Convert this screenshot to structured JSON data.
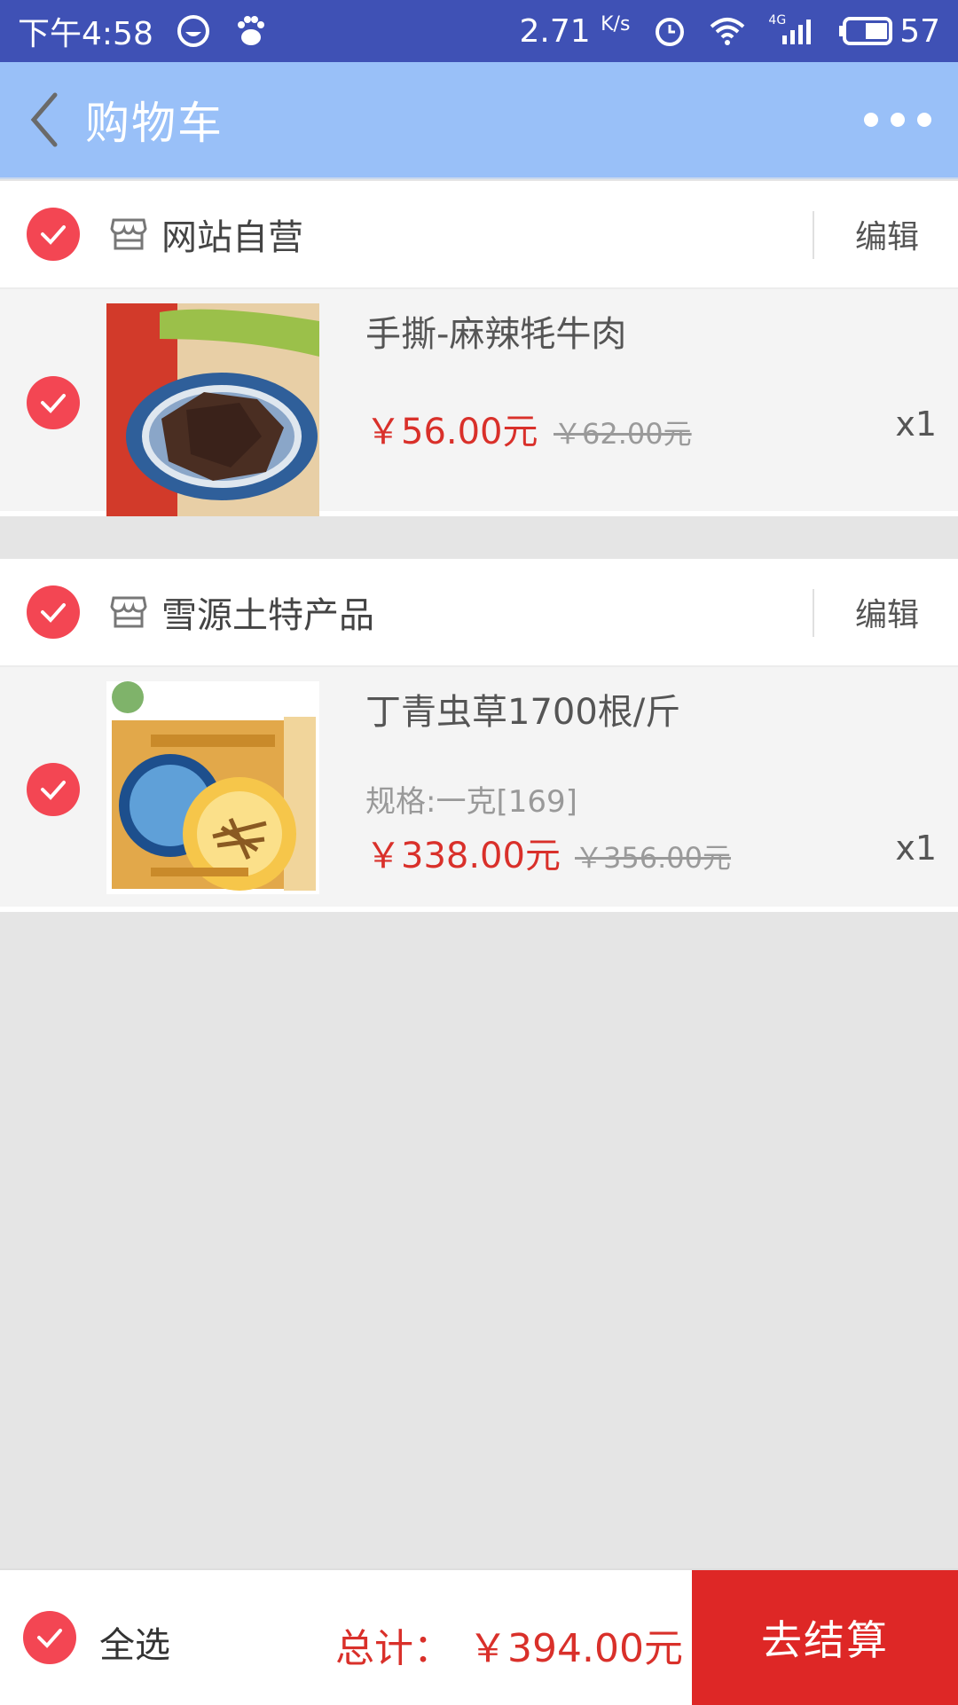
{
  "status_bar": {
    "time": "下午4:58",
    "speed": "2.71",
    "speed_unit": "K/s",
    "network_type": "4G",
    "battery": "57",
    "icons": [
      "face-icon",
      "baidu-paw-icon",
      "alarm-icon",
      "wifi-icon",
      "signal-icon",
      "battery-icon"
    ]
  },
  "app_bar": {
    "title": "购物车",
    "back_icon": "chevron-left-icon",
    "more_icon": "more-dots-icon"
  },
  "shops": [
    {
      "name": "网站自营",
      "edit_label": "编辑",
      "selected": true,
      "items": [
        {
          "name": "手撕-麻辣牦牛肉",
          "spec": "",
          "price": "￥56.00元",
          "original_price": "￥62.00元",
          "quantity": "x1",
          "selected": true
        }
      ]
    },
    {
      "name": "雪源土特产品",
      "edit_label": "编辑",
      "selected": true,
      "items": [
        {
          "name": "丁青虫草1700根/斤",
          "spec": "规格:一克[169]",
          "price": "￥338.00元",
          "original_price": "￥356.00元",
          "quantity": "x1",
          "selected": true
        }
      ]
    }
  ],
  "bottom_bar": {
    "select_all_label": "全选",
    "total_label": "总计：",
    "total_value": "￥394.00元",
    "checkout_label": "去结算"
  },
  "colors": {
    "status_bar": "#3f51b5",
    "app_bar": "#99c0f8",
    "check": "#f34653",
    "price": "#d9302a",
    "checkout": "#de2726"
  }
}
